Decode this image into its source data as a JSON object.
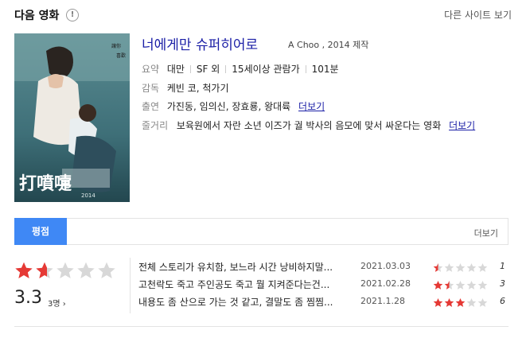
{
  "header": {
    "title": "다음 영화",
    "info_icon": "!",
    "other_sites": "다른 사이트 보기"
  },
  "movie": {
    "title": "너에게만 슈퍼히어로",
    "subtitle": "A Choo , 2014 제작",
    "summary_label": "요약",
    "country": "대만",
    "genre": "SF 외",
    "rating": "15세이상 관람가",
    "runtime": "101분",
    "director_label": "감독",
    "directors": "케빈 코, 척가기",
    "cast_label": "출연",
    "cast": "가진동, 임의신, 장효룡, 왕대륙",
    "plot_label": "줄거리",
    "plot": "보육원에서 자란 소년 이즈가 궐 박사의 음모에 맞서 싸운다는 영화",
    "more_label": "더보기",
    "poster_text": "打噴嚏"
  },
  "tabs": {
    "active": "평점",
    "more": "더보기"
  },
  "score": {
    "value": "3.3",
    "count": "3명",
    "chevron": "›",
    "stars_fraction": 0.33,
    "star_color": "#e53935",
    "empty_color": "#d8d8d8"
  },
  "reviews": [
    {
      "text": "전체 스토리가 유치함, 보느라 시간 낭비하지말...",
      "date": "2021.03.03",
      "score": "1",
      "stars": 0.5
    },
    {
      "text": "고천락도 죽고 주인공도 죽고 뭘 지켜준다는건...",
      "date": "2021.02.28",
      "score": "3",
      "stars": 1.5
    },
    {
      "text": "내용도 좀 산으로 가는 것 같고, 결말도 좀 찜찜...",
      "date": "2021.1.28",
      "score": "6",
      "stars": 3
    }
  ]
}
